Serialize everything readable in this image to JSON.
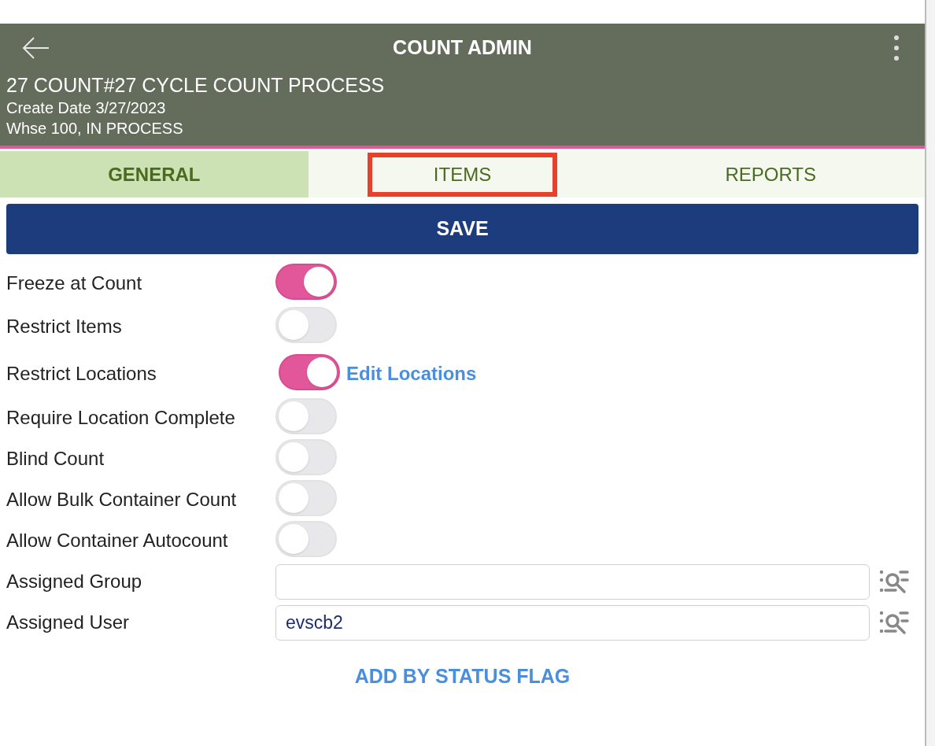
{
  "header": {
    "title": "COUNT ADMIN",
    "heading": "27 COUNT#27 CYCLE COUNT PROCESS",
    "create_date": "Create Date 3/27/2023",
    "status": "Whse 100, IN PROCESS"
  },
  "tabs": [
    {
      "label": "GENERAL",
      "selected": true,
      "highlighted": false
    },
    {
      "label": "ITEMS",
      "selected": false,
      "highlighted": true
    },
    {
      "label": "REPORTS",
      "selected": false,
      "highlighted": false
    }
  ],
  "save_button": "SAVE",
  "settings": [
    {
      "kind": "toggle",
      "label": "Freeze at Count",
      "on": true
    },
    {
      "kind": "toggle",
      "label": "Restrict Items",
      "on": false
    },
    {
      "kind": "toggle",
      "label": "Restrict Locations",
      "on": true,
      "link": "Edit Locations"
    },
    {
      "kind": "toggle",
      "label": "Require Location Complete",
      "on": false
    },
    {
      "kind": "toggle",
      "label": "Blind Count",
      "on": false
    },
    {
      "kind": "toggle",
      "label": "Allow Bulk Container Count",
      "on": false
    },
    {
      "kind": "toggle",
      "label": "Allow Container Autocount",
      "on": false
    },
    {
      "kind": "field",
      "label": "Assigned Group"
    },
    {
      "kind": "field",
      "label": "Assigned User",
      "value": "evscb2"
    }
  ],
  "add_link": "ADD BY STATUS FLAG"
}
